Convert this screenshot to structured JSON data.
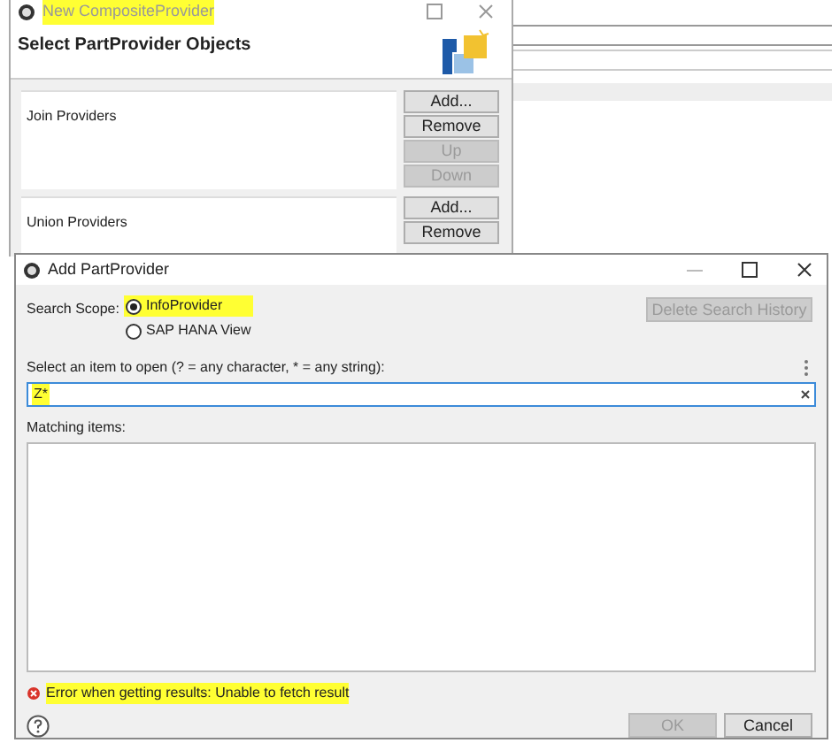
{
  "back_window": {
    "title": "New CompositeProvider",
    "title_highlighted": true,
    "heading": "Select PartProvider Objects",
    "sections": [
      {
        "label": "Join Providers",
        "buttons": [
          {
            "label": "Add...",
            "disabled": false
          },
          {
            "label": "Remove",
            "disabled": false
          },
          {
            "label": "Up",
            "disabled": true
          },
          {
            "label": "Down",
            "disabled": true
          }
        ]
      },
      {
        "label": "Union Providers",
        "buttons": [
          {
            "label": "Add...",
            "disabled": false
          },
          {
            "label": "Remove",
            "disabled": false
          }
        ]
      }
    ]
  },
  "dialog": {
    "title": "Add PartProvider",
    "search_scope_label": "Search Scope:",
    "scopes": [
      {
        "label": "InfoProvider",
        "selected": true,
        "highlighted": true
      },
      {
        "label": "SAP HANA View",
        "selected": false,
        "highlighted": false
      }
    ],
    "delete_history": {
      "label": "Delete Search History",
      "disabled": true
    },
    "prompt": "Select an item to open (? = any character, * = any string):",
    "search": {
      "value": "Z*",
      "highlighted": true
    },
    "matching_label": "Matching items:",
    "error": {
      "text": "Error when getting results: Unable to fetch result",
      "highlighted": true
    },
    "buttons": [
      {
        "label": "OK",
        "disabled": true
      },
      {
        "label": "Cancel",
        "disabled": false
      }
    ]
  }
}
